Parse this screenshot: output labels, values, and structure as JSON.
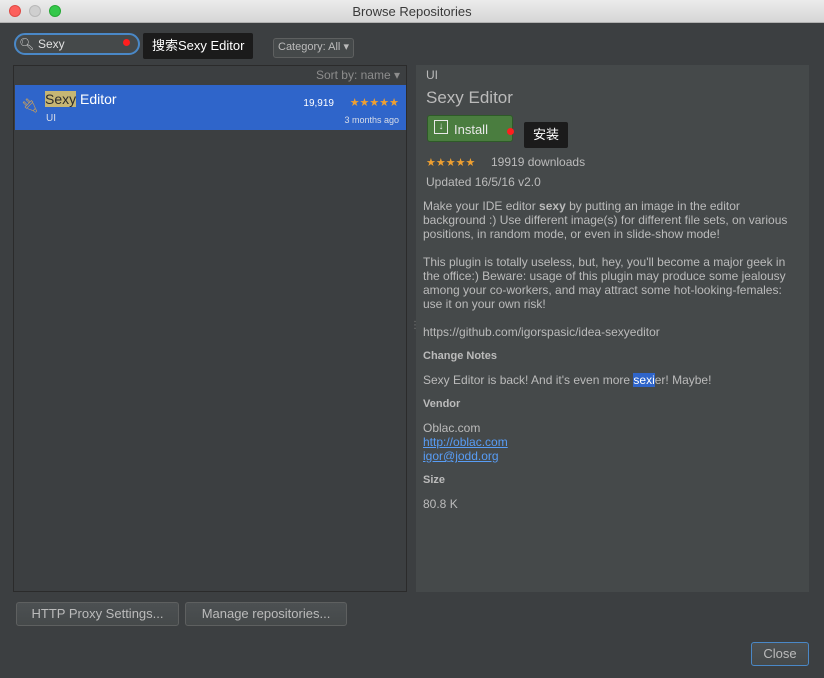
{
  "window": {
    "title": "Browse Repositories"
  },
  "search": {
    "value": "Sexy"
  },
  "search_tooltip": "搜索Sexy Editor",
  "category": {
    "label": "Category: All"
  },
  "list": {
    "sort_label": "Sort by: name ▾",
    "items": [
      {
        "name_highlight": "Sexy",
        "name_rest": " Editor",
        "category": "UI",
        "downloads": "19,919",
        "stars": "★★★★★",
        "updated": "3 months ago"
      }
    ]
  },
  "details": {
    "category": "UI",
    "title": "Sexy Editor",
    "install_label": "Install",
    "install_tooltip": "安装",
    "stars": "★★★★★",
    "downloads": "19919 downloads",
    "updated": "Updated 16/5/16   v2.0",
    "desc1_pre": "Make your IDE editor ",
    "desc1_bold": "sexy",
    "desc1_post": " by putting an image in the editor background :) Use different image(s) for different file sets, on various positions, in random mode, or even in slide-show mode!",
    "desc2": "This plugin is totally useless, but, hey, you'll become a major geek in the office:) Beware: usage of this plugin may produce some jealousy among your co-workers, and may attract some hot-looking-females: use it on your own risk!",
    "url": "https://github.com/igorspasic/idea-sexyeditor",
    "change_notes_heading": "Change Notes",
    "change_pre": "Sexy Editor is back! And it's even more ",
    "change_sel": "sexi",
    "change_post": "er! Maybe!",
    "vendor_heading": "Vendor",
    "vendor_name": "Oblac.com",
    "vendor_url": "http://oblac.com",
    "vendor_email": "igor@jodd.org",
    "size_heading": "Size",
    "size_value": "80.8 K"
  },
  "buttons": {
    "http_proxy": "HTTP Proxy Settings...",
    "manage_repos": "Manage repositories...",
    "close": "Close"
  },
  "colors": {
    "selection": "#2f65ca",
    "install_green": "#4a7d3f",
    "star": "#f0a030",
    "link": "#589df6"
  }
}
